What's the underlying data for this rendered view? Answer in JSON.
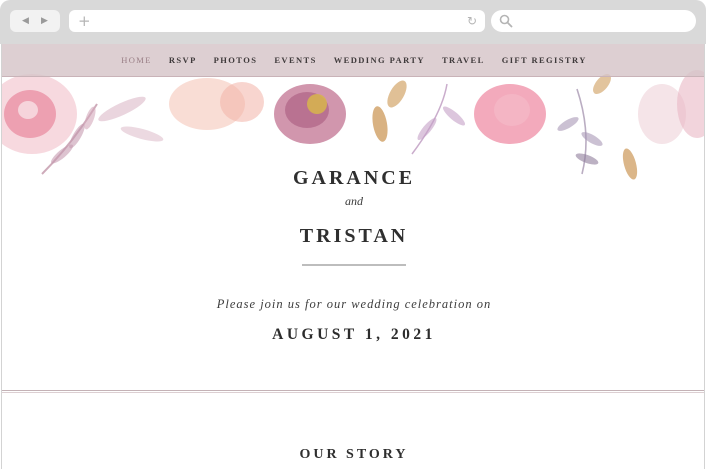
{
  "browser": {
    "back_icon": "back-arrow-icon",
    "forward_icon": "forward-arrow-icon",
    "new_tab_icon": "plus-icon",
    "reload_icon": "reload-icon",
    "search_icon": "search-icon"
  },
  "nav": {
    "items": [
      {
        "label": "HOME"
      },
      {
        "label": "RSVP"
      },
      {
        "label": "PHOTOS"
      },
      {
        "label": "EVENTS"
      },
      {
        "label": "WEDDING PARTY"
      },
      {
        "label": "TRAVEL"
      },
      {
        "label": "GIFT REGISTRY"
      }
    ]
  },
  "hero": {
    "name1": "GARANCE",
    "and": "and",
    "name2": "TRISTAN",
    "invite": "Please join us for our wedding celebration on",
    "date": "AUGUST 1, 2021"
  },
  "story": {
    "heading": "OUR STORY"
  },
  "colors": {
    "nav_bg": "#d6c4c8",
    "accent_pink": "#e58aa0",
    "accent_gold": "#c99a5a",
    "text_dark": "#2f2f2f"
  }
}
